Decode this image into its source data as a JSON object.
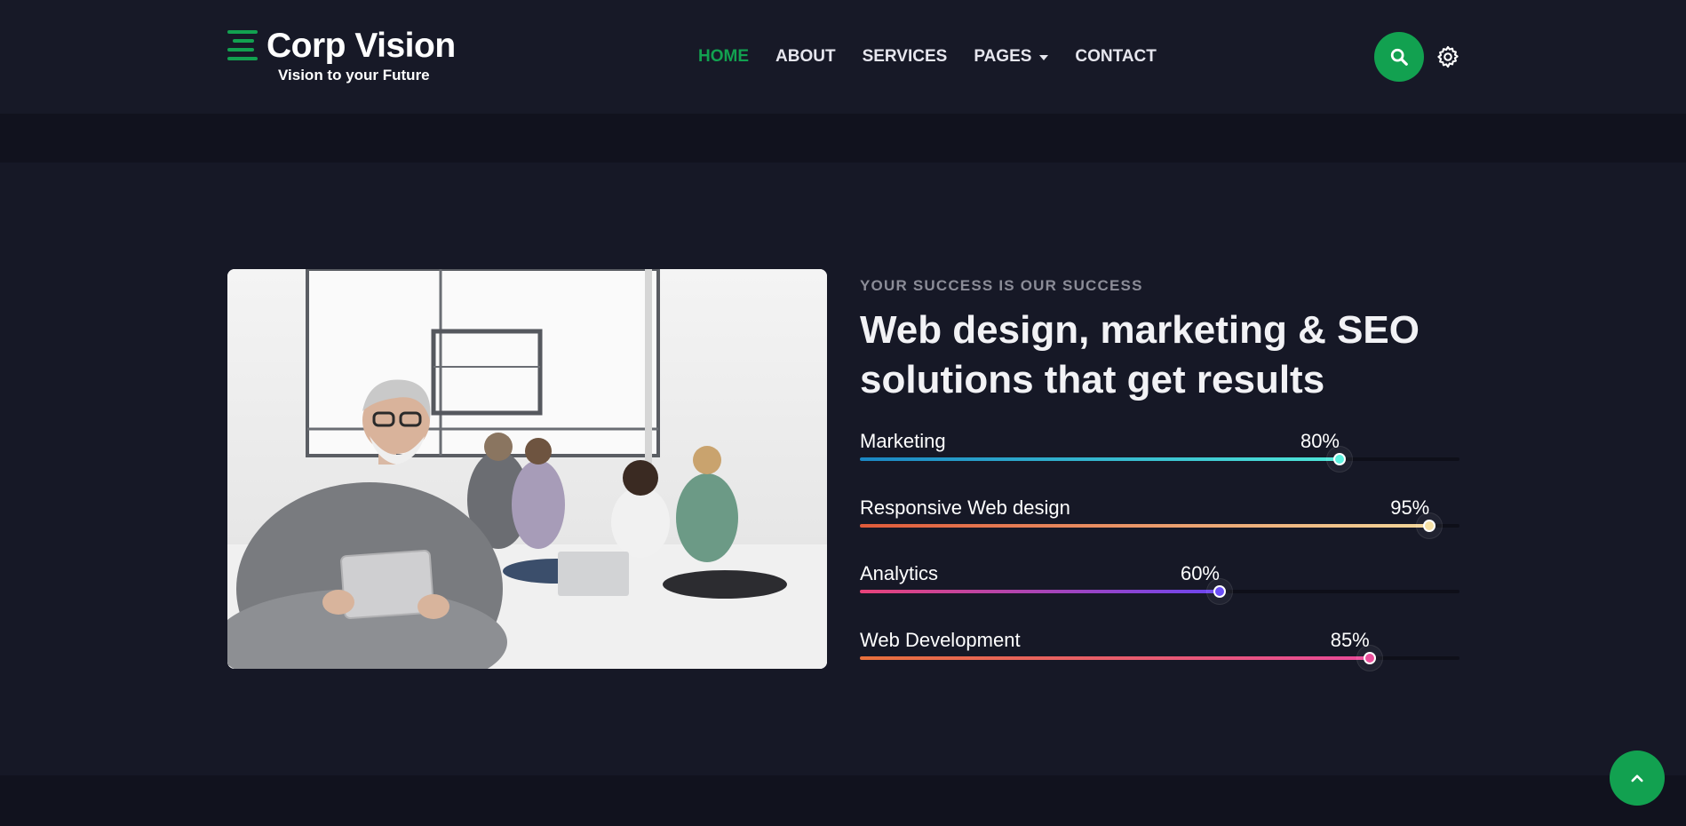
{
  "brand": {
    "name": "Corp Vision",
    "tagline": "Vision to your Future",
    "accent_color": "#12a150"
  },
  "nav": {
    "items": [
      {
        "label": "HOME",
        "active": true
      },
      {
        "label": "ABOUT",
        "active": false
      },
      {
        "label": "SERVICES",
        "active": false
      },
      {
        "label": "PAGES",
        "active": false,
        "has_dropdown": true
      },
      {
        "label": "CONTACT",
        "active": false
      }
    ],
    "search_icon": "search-icon",
    "settings_icon": "gear-icon"
  },
  "section": {
    "eyebrow": "YOUR SUCCESS IS OUR SUCCESS",
    "headline": "Web design, marketing & SEO solutions that get results",
    "image": "office-team-photo"
  },
  "skills": [
    {
      "label": "Marketing",
      "value_text": "80%",
      "value": 80,
      "gradient": [
        "#1b87c4",
        "#4fe7d9"
      ],
      "knob_color": "#5ef1e0"
    },
    {
      "label": "Responsive Web design",
      "value_text": "95%",
      "value": 95,
      "gradient": [
        "#e05a3a",
        "#f3d79a"
      ],
      "knob_color": "#f6e1a6"
    },
    {
      "label": "Analytics",
      "value_text": "60%",
      "value": 60,
      "gradient": [
        "#e8437a",
        "#6b45f0"
      ],
      "knob_color": "#6b4ff6"
    },
    {
      "label": "Web Development",
      "value_text": "85%",
      "value": 85,
      "gradient": [
        "#e8703c",
        "#e84a9a"
      ],
      "knob_color": "#ea4f9b"
    }
  ],
  "scroll_top_icon": "chevron-up-icon"
}
